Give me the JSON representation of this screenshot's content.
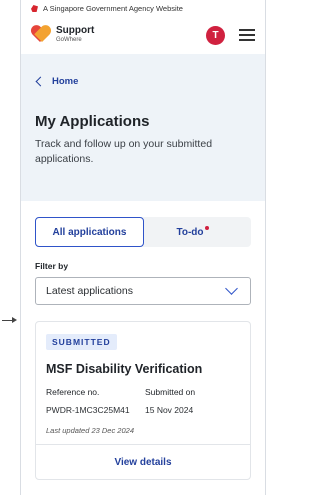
{
  "banner": {
    "text": "A Singapore Government Agency Website"
  },
  "brand": {
    "name": "Support",
    "sub": "GoWhere"
  },
  "user": {
    "initial": "T"
  },
  "breadcrumb": {
    "home": "Home"
  },
  "page": {
    "title": "My Applications",
    "subtitle": "Track and follow up on your submitted applications."
  },
  "tabs": [
    {
      "label": "All applications",
      "active": true
    },
    {
      "label": "To-do",
      "active": false,
      "has_notification": true
    }
  ],
  "filter": {
    "label": "Filter by",
    "selected": "Latest applications"
  },
  "application": {
    "status": "SUBMITTED",
    "title": "MSF Disability Verification",
    "ref_label": "Reference no.",
    "submitted_label": "Submitted on",
    "ref_value": "PWDR-1MC3C25M41",
    "submitted_value": "15 Nov 2024",
    "updated": "Last updated 23 Dec 2024",
    "action": "View details"
  },
  "colors": {
    "primary": "#23409c",
    "accent": "#d0213f",
    "hero_bg": "#eef3f8"
  }
}
